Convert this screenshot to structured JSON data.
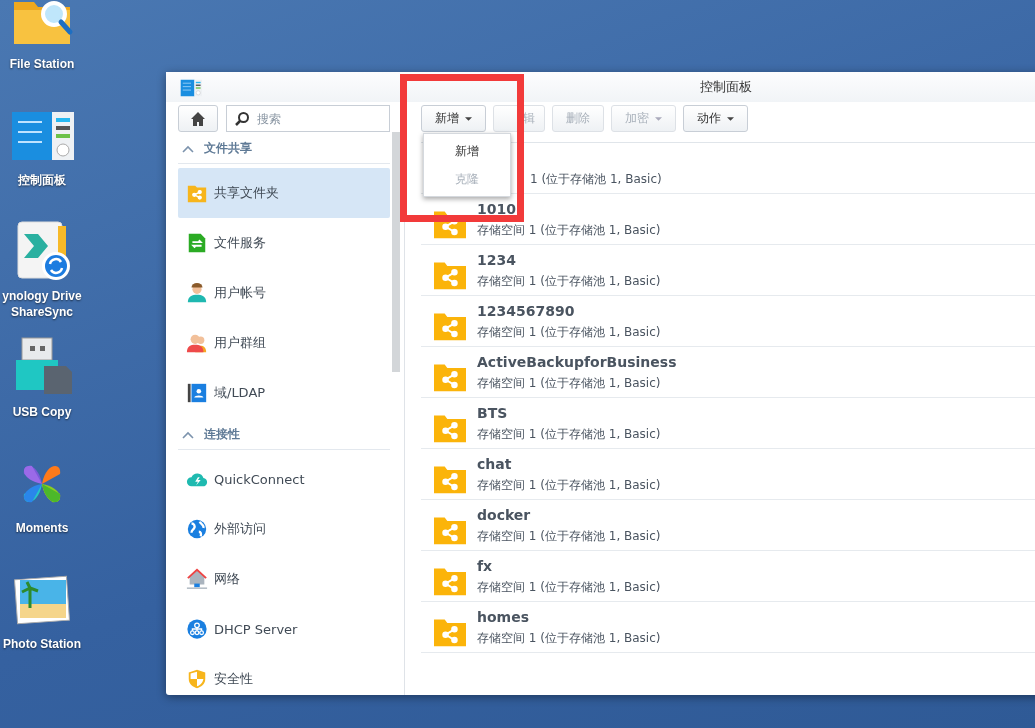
{
  "desktop": {
    "icons": [
      {
        "kind": "file-station",
        "label": "File Station"
      },
      {
        "kind": "control-panel",
        "label": "控制面板"
      },
      {
        "kind": "drive-sync",
        "label": "ynology Drive\nShareSync"
      },
      {
        "kind": "usb-copy",
        "label": "USB Copy"
      },
      {
        "kind": "moments",
        "label": "Moments"
      },
      {
        "kind": "photo-station",
        "label": "Photo Station"
      }
    ]
  },
  "window": {
    "title": "控制面板"
  },
  "sidebar": {
    "search": {
      "placeholder": "搜索"
    },
    "sections": [
      {
        "title": "文件共享",
        "expanded": true,
        "items": [
          {
            "kind": "folder",
            "label": "共享文件夹",
            "selected": true
          },
          {
            "kind": "services",
            "label": "文件服务",
            "selected": false
          },
          {
            "kind": "user",
            "label": "用户帐号",
            "selected": false
          },
          {
            "kind": "group",
            "label": "用户群组",
            "selected": false
          },
          {
            "kind": "directory",
            "label": "域/LDAP",
            "selected": false
          }
        ]
      },
      {
        "title": "连接性",
        "expanded": true,
        "items": [
          {
            "kind": "cloud",
            "label": "QuickConnect",
            "selected": false
          },
          {
            "kind": "globe",
            "label": "外部访问",
            "selected": false
          },
          {
            "kind": "network",
            "label": "网络",
            "selected": false
          },
          {
            "kind": "dhcp",
            "label": "DHCP Server",
            "selected": false
          },
          {
            "kind": "shield",
            "label": "安全性",
            "selected": false
          }
        ]
      }
    ]
  },
  "toolbar": [
    {
      "label": "新增",
      "dropdown": true,
      "disabled": false
    },
    {
      "label": "辑",
      "dropdown": false,
      "disabled": true
    },
    {
      "label": "删除",
      "dropdown": false,
      "disabled": true
    },
    {
      "label": "加密",
      "dropdown": true,
      "disabled": true
    },
    {
      "label": "动作",
      "dropdown": true,
      "disabled": false
    }
  ],
  "dropdown_menu": [
    {
      "label": "新增",
      "disabled": false
    },
    {
      "label": "克隆",
      "disabled": true
    }
  ],
  "shared_folders": [
    {
      "description": "1 (位于存储池 1, Basic)"
    },
    {
      "name": "1010",
      "description": "存储空间 1 (位于存储池 1, Basic)"
    },
    {
      "name": "1234",
      "description": "存储空间 1 (位于存储池 1, Basic)"
    },
    {
      "name": "1234567890",
      "description": "存储空间 1 (位于存储池 1, Basic)"
    },
    {
      "name": "ActiveBackupforBusiness",
      "description": "存储空间 1 (位于存储池 1, Basic)"
    },
    {
      "name": "BTS",
      "description": "存储空间 1 (位于存储池 1, Basic)"
    },
    {
      "name": "chat",
      "description": "存储空间 1 (位于存储池 1, Basic)"
    },
    {
      "name": "docker",
      "description": "存储空间 1 (位于存储池 1, Basic)"
    },
    {
      "name": "fx",
      "description": "存储空间 1 (位于存储池 1, Basic)"
    },
    {
      "name": "homes",
      "description": "存储空间 1 (位于存储池 1, Basic)"
    }
  ]
}
